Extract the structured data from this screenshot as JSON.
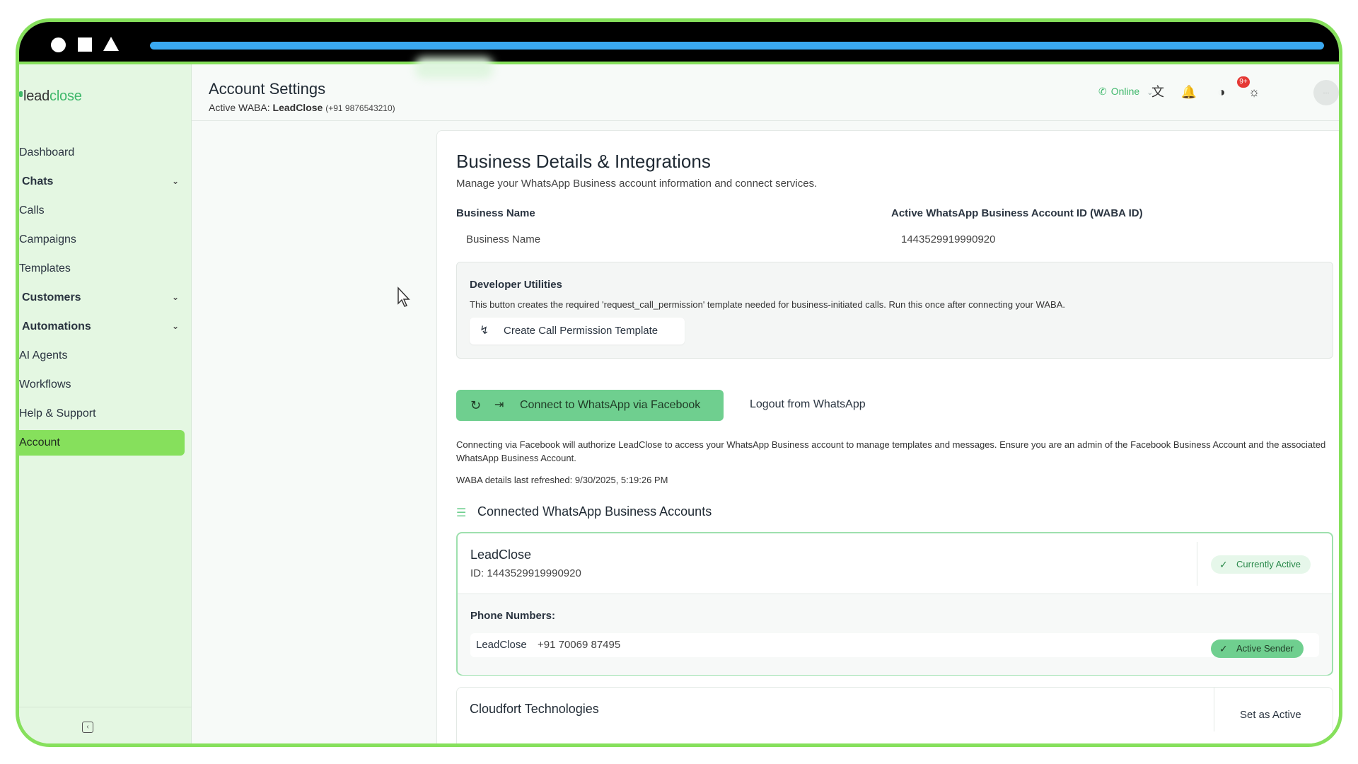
{
  "browser": {
    "progress_percent": 100
  },
  "sidebar": {
    "logo_lead": "lead",
    "logo_close": "close",
    "items": [
      {
        "label": "Dashboard"
      },
      {
        "label": "Chats",
        "expandable": true
      },
      {
        "label": "Calls"
      },
      {
        "label": "Campaigns"
      },
      {
        "label": "Templates"
      },
      {
        "label": "Customers",
        "expandable": true
      },
      {
        "label": "Automations",
        "expandable": true
      },
      {
        "label": "AI Agents"
      },
      {
        "label": "Workflows"
      },
      {
        "label": "Help & Support"
      },
      {
        "label": "Account",
        "active": true
      }
    ]
  },
  "header": {
    "title": "Account Settings",
    "waba_prefix": "Active WABA:",
    "waba_name": "LeadClose",
    "waba_phone": "(+91 9876543210)",
    "status": "Online",
    "notification_badge": "9+"
  },
  "main": {
    "title": "Business Details & Integrations",
    "subtitle": "Manage your WhatsApp Business account information and connect services.",
    "business_name_label": "Business Name",
    "business_name_value": "Business Name",
    "waba_id_label": "Active WhatsApp Business Account ID (WABA ID)",
    "waba_id_value": "1443529919990920",
    "dev_utilities": {
      "title": "Developer Utilities",
      "description": "This button creates the required 'request_call_permission' template needed for business-initiated calls. Run this once after connecting your WABA.",
      "button_label": "Create Call Permission Template"
    },
    "connect_button": "Connect to WhatsApp via Facebook",
    "logout_link": "Logout from WhatsApp",
    "note": "Connecting via Facebook will authorize LeadClose to access your WhatsApp Business account to manage templates and messages. Ensure you are an admin of the Facebook Business Account and the associated WhatsApp Business Account.",
    "refreshed": "WABA details last refreshed: 9/30/2025, 5:19:26 PM",
    "connected_title": "Connected WhatsApp Business Accounts",
    "accounts": [
      {
        "name": "LeadClose",
        "id": "ID: 1443529919990920",
        "status": "Currently Active",
        "phone_label": "Phone Numbers:",
        "phones": [
          {
            "name": "LeadClose",
            "number": "+91 70069 87495",
            "badge": "Active Sender"
          }
        ]
      },
      {
        "name": "Cloudfort Technologies",
        "action": "Set as Active"
      }
    ]
  },
  "colors": {
    "accent_green": "#86e05c",
    "button_green": "#6fcf8f",
    "sidebar_bg": "#e4f7e2"
  }
}
